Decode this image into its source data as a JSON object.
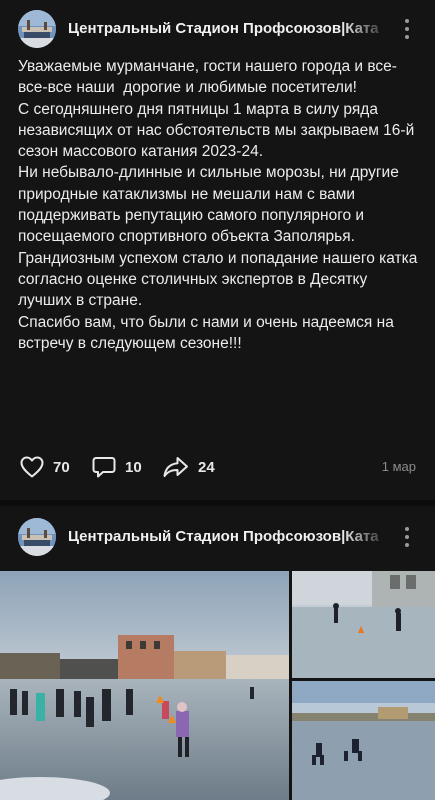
{
  "posts": [
    {
      "channel_name": "Центральный Стадион Профсоюзов|Ката",
      "text": "Уважаемые мурманчане, гости нашего города и все-все-все наши  дорогие и любимые посетители!\nС сегодняшнего дня пятницы 1 марта в силу ряда независящих от нас обстоятельств мы закрываем 16-й сезон массового катания 2023-24.\nНи небывало-длинные и сильные морозы, ни другие природные катаклизмы не мешали нам с вами поддерживать репутацию самого популярного и посещаемого спортивного объекта Заполярья.\nГрандиозным успехом стало и попадание нашего катка согласно оценке столичных экспертов в Десятку лучших в стране.\nСпасибо вам, что были с нами и очень надеемся на встречу в следующем сезоне!!!",
      "likes": "70",
      "comments": "10",
      "shares": "24",
      "date": "1 мар"
    },
    {
      "channel_name": "Центральный Стадион Профсоюзов|Ката"
    }
  ],
  "icons": {
    "like": "heart-icon",
    "comment": "comment-icon",
    "share": "share-icon",
    "more": "more-vertical-icon"
  },
  "colors": {
    "background": "#141414",
    "text": "#ececec",
    "muted": "#8c8c8c"
  }
}
